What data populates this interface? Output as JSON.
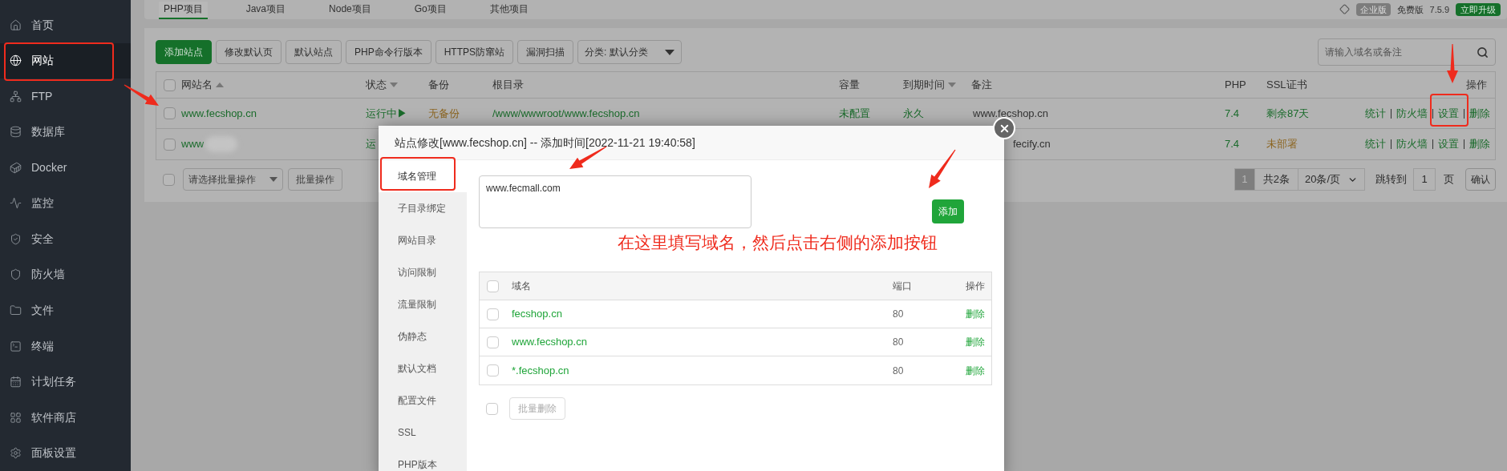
{
  "sidebar": {
    "items": [
      {
        "label": "首页",
        "selected": false
      },
      {
        "label": "网站",
        "selected": true
      },
      {
        "label": "FTP",
        "selected": false
      },
      {
        "label": "数据库",
        "selected": false
      },
      {
        "label": "Docker",
        "selected": false
      },
      {
        "label": "监控",
        "selected": false
      },
      {
        "label": "安全",
        "selected": false
      },
      {
        "label": "防火墙",
        "selected": false
      },
      {
        "label": "文件",
        "selected": false
      },
      {
        "label": "终端",
        "selected": false
      },
      {
        "label": "计划任务",
        "selected": false
      },
      {
        "label": "软件商店",
        "selected": false
      },
      {
        "label": "面板设置",
        "selected": false
      }
    ]
  },
  "project_tabs": [
    {
      "label": "PHP项目",
      "selected": true
    },
    {
      "label": "Java项目",
      "selected": false
    },
    {
      "label": "Node项目",
      "selected": false
    },
    {
      "label": "Go项目",
      "selected": false
    },
    {
      "label": "其他项目",
      "selected": false
    }
  ],
  "top_right": {
    "badge": "企业版",
    "edition": "免费版",
    "version": "7.5.9",
    "upgrade_button": "立即升级"
  },
  "toolbar": {
    "buttons": [
      {
        "label": "添加站点",
        "kind": "primary"
      },
      {
        "label": "修改默认页",
        "kind": "default"
      },
      {
        "label": "默认站点",
        "kind": "default"
      },
      {
        "label": "PHP命令行版本",
        "kind": "default"
      },
      {
        "label": "HTTPS防窜站",
        "kind": "default"
      },
      {
        "label": "漏洞扫描",
        "kind": "default"
      }
    ],
    "category_select": "分类: 默认分类",
    "search": {
      "placeholder": "请输入域名或备注"
    }
  },
  "sites_table": {
    "all_checked": false,
    "columns": [
      {
        "label": "网站名",
        "sort_ascending": true
      },
      {
        "label": "状态",
        "sort_ascending": false
      },
      {
        "label": "备份"
      },
      {
        "label": "根目录"
      },
      {
        "label": "容量"
      },
      {
        "label": "到期时间",
        "sort_ascending": false
      },
      {
        "label": "备注"
      },
      {
        "label": "PHP"
      },
      {
        "label": "SSL证书"
      },
      {
        "label": "操作"
      }
    ],
    "rows": [
      {
        "checked": false,
        "name": "www.fecshop.cn",
        "status": "运行中▶",
        "backup": "无备份",
        "root": "/www/wwwroot/www.fecshop.cn",
        "capacity": "未配置",
        "expiry": "永久",
        "remark": "www.fecshop.cn",
        "php": "7.4",
        "ssl": "剩余87天",
        "ssl_ok": true,
        "actions": [
          "统计",
          "防火墙",
          "设置",
          "删除"
        ]
      },
      {
        "checked": false,
        "name": "www",
        "status": "运",
        "remark": "fecify.cn",
        "php": "7.4",
        "ssl": "未部署",
        "ssl_ok": false,
        "actions": [
          "统计",
          "防火墙",
          "设置",
          "删除"
        ]
      }
    ]
  },
  "batch": {
    "checked": false,
    "select_placeholder": "请选择批量操作",
    "button": "批量操作"
  },
  "pagination": {
    "pages": [
      {
        "label": "1",
        "selected": true
      }
    ],
    "total": "共2条",
    "page_size": "20条/页",
    "jump_label": "跳转到",
    "jump_value": "1",
    "page_unit": "页",
    "confirm_button": "确认"
  },
  "dialog": {
    "title": "站点修改[www.fecshop.cn] -- 添加时间[2022-11-21 19:40:58]",
    "nav": [
      {
        "label": "域名管理",
        "selected": true
      },
      {
        "label": "子目录绑定",
        "selected": false
      },
      {
        "label": "网站目录",
        "selected": false
      },
      {
        "label": "访问限制",
        "selected": false
      },
      {
        "label": "流量限制",
        "selected": false
      },
      {
        "label": "伪静态",
        "selected": false
      },
      {
        "label": "默认文档",
        "selected": false
      },
      {
        "label": "配置文件",
        "selected": false
      },
      {
        "label": "SSL",
        "selected": false
      },
      {
        "label": "PHP版本",
        "selected": false
      }
    ],
    "domain_input": {
      "value": "www.fecmall.com"
    },
    "add_button": "添加",
    "domains_table": {
      "all_checked": false,
      "columns": [
        "域名",
        "端口",
        "操作"
      ],
      "rows": [
        {
          "checked": false,
          "domain": "fecshop.cn",
          "port": "80",
          "action": "删除"
        },
        {
          "checked": false,
          "domain": "www.fecshop.cn",
          "port": "80",
          "action": "删除"
        },
        {
          "checked": false,
          "domain": "*.fecshop.cn",
          "port": "80",
          "action": "删除"
        }
      ]
    },
    "batch_checked": false,
    "batch_delete_button": "批量删除"
  },
  "annotation": {
    "note": "在这里填写域名，然后点击右侧的添加按钮"
  }
}
